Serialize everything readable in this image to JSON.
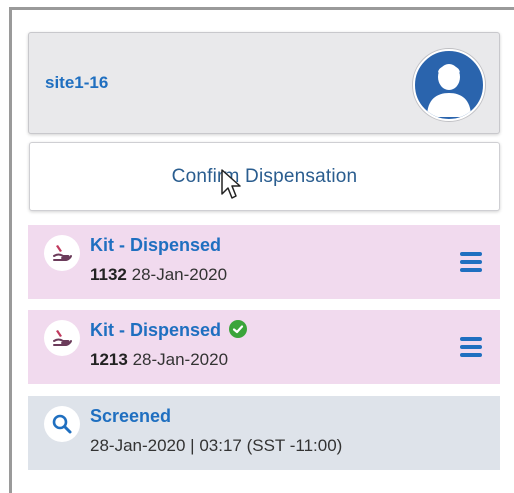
{
  "header": {
    "site_name": "site1-16",
    "avatar_icon": "user-avatar-icon"
  },
  "confirm_button": {
    "label": "Confirm Dispensation"
  },
  "timeline": {
    "entries": [
      {
        "type": "dispensed",
        "icon": "hand-kit-icon",
        "title": "Kit - Dispensed",
        "kit_number": "1132",
        "date": "28-Jan-2020",
        "verified": false,
        "menu_icon": "hamburger-menu-icon"
      },
      {
        "type": "dispensed",
        "icon": "hand-kit-icon",
        "title": "Kit - Dispensed",
        "kit_number": "1213",
        "date": "28-Jan-2020",
        "verified": true,
        "verified_icon": "check-circle-icon",
        "menu_icon": "hamburger-menu-icon"
      },
      {
        "type": "screened",
        "icon": "search-icon",
        "title": "Screened",
        "detail": "28-Jan-2020 | 03:17 (SST -11:00)"
      }
    ]
  },
  "colors": {
    "accent_blue": "#1f6fc0",
    "dispensed_bg": "#f1daee",
    "screened_bg": "#dee3ea",
    "verified_green": "#3aa43a",
    "avatar_bg": "#2a64ad"
  }
}
